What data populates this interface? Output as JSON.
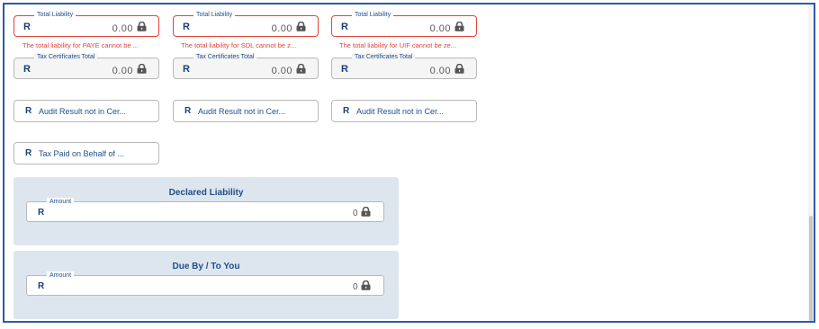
{
  "currency_symbol": "R",
  "lock_color": "#555555",
  "liability_fields": [
    {
      "legend": "Total Liability",
      "value": "0.00",
      "error": "The total liability for PAYE cannot be ..."
    },
    {
      "legend": "Total Liability",
      "value": "0.00",
      "error": "The total liability for SDL cannot be z..."
    },
    {
      "legend": "Total Liability",
      "value": "0.00",
      "error": "The total liability for UIF cannot be ze..."
    }
  ],
  "certificate_fields": [
    {
      "legend": "Tax Certificates Total",
      "value": "0.00"
    },
    {
      "legend": "Tax Certificates Total",
      "value": "0.00"
    },
    {
      "legend": "Tax Certificates Total",
      "value": "0.00"
    }
  ],
  "audit_buttons": [
    {
      "label": "Audit Result not in Cer..."
    },
    {
      "label": "Audit Result not in Cer..."
    },
    {
      "label": "Audit Result not in Cer..."
    }
  ],
  "tax_paid_button": {
    "label": "Tax Paid on Behalf of ..."
  },
  "declared_liability": {
    "title": "Declared Liability",
    "legend": "Amount",
    "value": "0"
  },
  "due_by": {
    "title": "Due By / To You",
    "legend": "Amount",
    "value": "0"
  }
}
